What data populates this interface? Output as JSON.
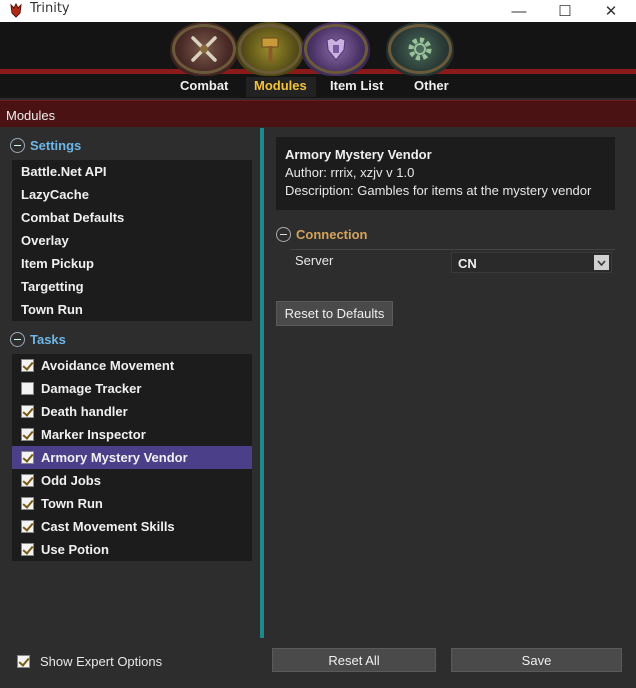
{
  "window": {
    "title": "Trinity",
    "minimize_glyph": "—",
    "maximize_glyph": "☐",
    "close_glyph": "✕"
  },
  "nav": {
    "tabs": [
      {
        "label": "Combat",
        "icon": "crossed-swords-icon"
      },
      {
        "label": "Modules",
        "icon": "hammer-icon"
      },
      {
        "label": "Item List",
        "icon": "armor-icon"
      },
      {
        "label": "Other",
        "icon": "gear-icon"
      }
    ],
    "active_tab": "Modules"
  },
  "section": {
    "title": "Modules"
  },
  "settings": {
    "label": "Settings",
    "items": [
      "Battle.Net API",
      "LazyCache",
      "Combat Defaults",
      "Overlay",
      "Item Pickup",
      "Targetting",
      "Town Run"
    ]
  },
  "tasks": {
    "label": "Tasks",
    "items": [
      {
        "label": "Avoidance Movement",
        "checked": true
      },
      {
        "label": "Damage Tracker",
        "checked": false
      },
      {
        "label": "Death handler",
        "checked": true
      },
      {
        "label": "Marker Inspector",
        "checked": true
      },
      {
        "label": "Armory Mystery Vendor",
        "checked": true,
        "selected": true
      },
      {
        "label": "Odd Jobs",
        "checked": true
      },
      {
        "label": "Town Run",
        "checked": true
      },
      {
        "label": "Cast Movement Skills",
        "checked": true
      },
      {
        "label": "Use Potion",
        "checked": true
      }
    ]
  },
  "module_info": {
    "name": "Armory Mystery Vendor",
    "author_line": "Author: rrrix, xzjv    v 1.0",
    "description_line": "Description: Gambles for items at the mystery vendor"
  },
  "connection": {
    "label": "Connection",
    "server_label": "Server",
    "server_value": "CN"
  },
  "buttons": {
    "reset_defaults": "Reset to Defaults",
    "reset_all": "Reset All",
    "save": "Save"
  },
  "footer": {
    "show_expert_label": "Show Expert Options",
    "show_expert_checked": true
  },
  "colors": {
    "accent_tab": "#f3c33a",
    "settings_header": "#6cb6e8",
    "connection_header": "#d4a35a",
    "selected_row": "#4c3f8a",
    "divider": "#1c8a8a",
    "section_bar": "#4a1212"
  }
}
